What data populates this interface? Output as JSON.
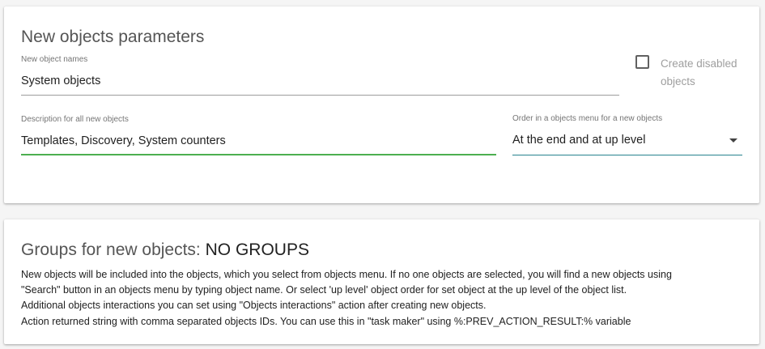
{
  "params": {
    "title": "New objects parameters",
    "names": {
      "label": "New object names",
      "value": "System objects"
    },
    "create_disabled": {
      "label": "Create disabled objects",
      "checked": false
    },
    "description": {
      "label": "Description for all new objects",
      "value": "Templates, Discovery, System counters"
    },
    "order": {
      "label": "Order in a objects menu for a new objects",
      "value": "At the end and at up level",
      "icon": "caret-down-icon"
    }
  },
  "groups": {
    "title": "Groups for new objects:",
    "title_value": "NO GROUPS",
    "lines": [
      "New objects will be included into the objects, which you select from objects menu. If no one objects are selected, you will find a new objects using",
      "\"Search\" button in an objects menu by typing object name. Or select 'up level' object order for set object at the up level of the object list.",
      "Additional objects interactions you can set using \"Objects interactions\" action after creating new objects.",
      "Action returned string with comma separated objects IDs. You can use this in \"task maker\" using %:PREV_ACTION_RESULT:% variable"
    ]
  },
  "colors": {
    "focus_underline": "#4caf50",
    "select_underline": "#26838f",
    "background": "#f5f5f5",
    "card": "#ffffff"
  }
}
